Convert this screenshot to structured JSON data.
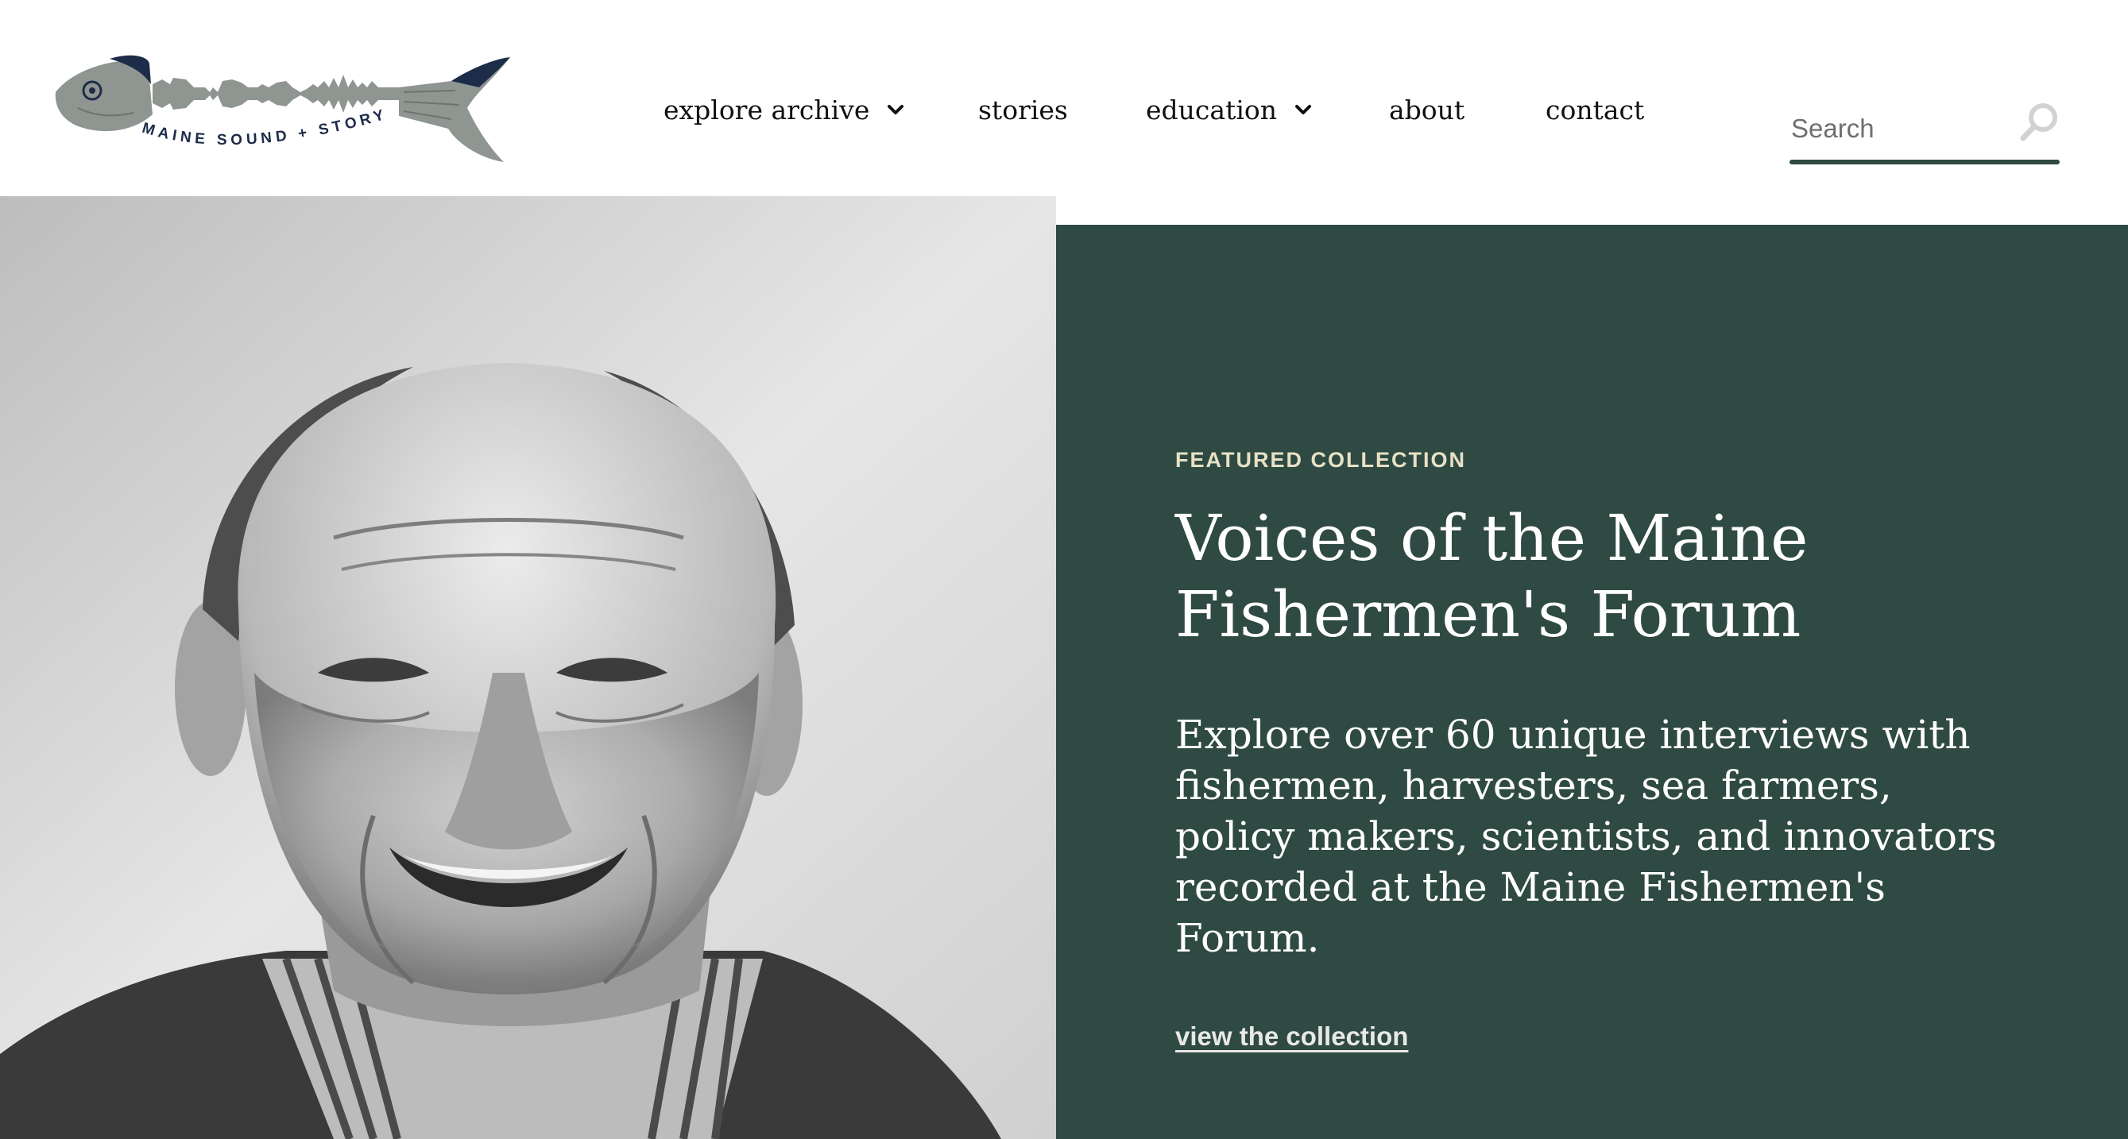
{
  "brand": {
    "logo_text": "MAINE SOUND + STORY"
  },
  "nav": {
    "items": [
      {
        "label": "explore archive",
        "has_dropdown": true
      },
      {
        "label": "stories",
        "has_dropdown": false
      },
      {
        "label": "education",
        "has_dropdown": true
      },
      {
        "label": "about",
        "has_dropdown": false
      },
      {
        "label": "contact",
        "has_dropdown": false
      }
    ]
  },
  "search": {
    "placeholder": "Search",
    "value": "",
    "icon": "search-icon"
  },
  "hero": {
    "eyebrow": "FEATURED COLLECTION",
    "title": "Voices of the Maine Fishermen's Forum",
    "description": "Explore over 60 unique interviews with fishermen, harvesters, sea farmers, policy makers, scientists, and innovators recorded at the Maine Fishermen's Forum.",
    "link_label": "view the collection",
    "photo": "black-and-white portrait of smiling older fisherman"
  },
  "colors": {
    "panel_green": "#2f4a43",
    "eyebrow_cream": "#e8e1c6",
    "logo_navy": "#1d2c48",
    "logo_grey": "#8f9590"
  }
}
